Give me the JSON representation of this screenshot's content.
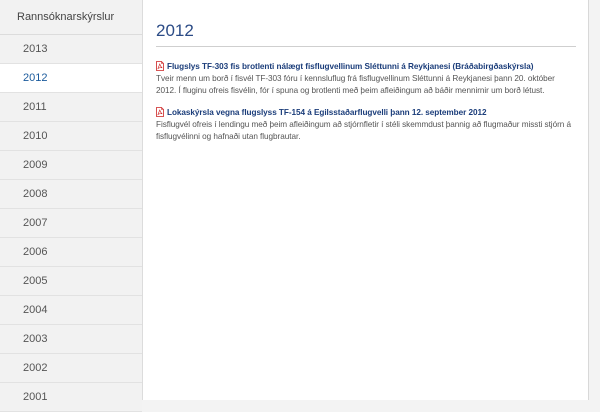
{
  "sidebar": {
    "header": "Rannsóknarskýrslur",
    "items": [
      "2013",
      "2012",
      "2011",
      "2010",
      "2009",
      "2008",
      "2007",
      "2006",
      "2005",
      "2004",
      "2003",
      "2002",
      "2001"
    ],
    "active": "2012"
  },
  "main": {
    "title": "2012",
    "entries": [
      {
        "icon": "pdf-icon",
        "title": "Flugslys TF-303 fis brotlenti nálægt fisflugvellinum Sléttunni á Reykjanesi (Bráðabirgðaskýrsla)",
        "description": "Tveir menn um borð í fisvél TF-303 fóru í kennsluflug frá fisflugvellinum Sléttunni á Reykjanesi þann 20. október 2012. Í fluginu ofreis fisvélin, fór í spuna og brotlenti með þeim afleiðingum að báðir mennirnir um borð létust."
      },
      {
        "icon": "pdf-icon",
        "title": "Lokaskýrsla vegna flugslyss TF-154 á Egilsstaðarflugvelli þann 12. september 2012",
        "description": "Fisflugvél ofreis í lendingu með þeim afleiðingum að stjórnfletir í stéli skemmdust þannig að flugmaður missti stjórn á fisflugvélinni og hafnaði utan flugbrautar."
      }
    ]
  },
  "colors": {
    "accent": "#1a5a9c",
    "title": "#2b4b86",
    "link": "#1b3d7a",
    "pdf": "#cc2222"
  }
}
